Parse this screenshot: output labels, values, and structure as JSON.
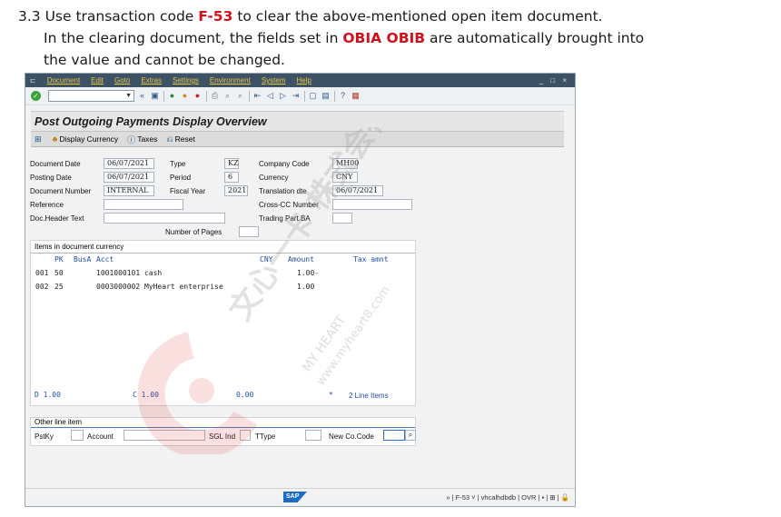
{
  "doc": {
    "line1_prefix": "3.3 Use transaction code ",
    "line1_code": "F-53",
    "line1_suffix": " to clear the above-mentioned open item document.",
    "line2_prefix": "In the clearing document, the fields set in ",
    "line2_fields": "OBIA OBIB",
    "line2_suffix": " are automatically brought into",
    "line3": "the value and cannot be changed."
  },
  "menu": [
    "Document",
    "Edit",
    "Goto",
    "Extras",
    "Settings",
    "Environment",
    "System",
    "Help"
  ],
  "window_controls": "_ □ ×",
  "title": "Post Outgoing Payments Display Overview",
  "app_toolbar": {
    "display_currency": "Display Currency",
    "taxes": "Taxes",
    "reset": "Reset"
  },
  "header": {
    "document_date_label": "Document Date",
    "document_date": "06/07/2021",
    "type_label": "Type",
    "type": "KZ",
    "company_code_label": "Company Code",
    "company_code": "MH00",
    "posting_date_label": "Posting Date",
    "posting_date": "06/07/2021",
    "period_label": "Period",
    "period": "6",
    "currency_label": "Currency",
    "currency": "CNY",
    "document_number_label": "Document Number",
    "document_number": "INTERNAL",
    "fiscal_year_label": "Fiscal Year",
    "fiscal_year": "2021",
    "translation_date_label": "Translation dte",
    "translation_date": "06/07/2021",
    "reference_label": "Reference",
    "reference": "",
    "cross_cc_label": "Cross-CC Number",
    "cross_cc": "",
    "doc_header_text_label": "Doc.Header Text",
    "doc_header_text": "",
    "trading_part_label": "Trading Part.BA",
    "trading_part": "",
    "number_of_pages_label": "Number of Pages",
    "number_of_pages": ""
  },
  "items": {
    "section_title": "Items in document currency",
    "col_pk": "PK",
    "col_busa": "BusA",
    "col_acct": "Acct",
    "col_currency": "CNY",
    "col_amount": "Amount",
    "col_tax": "Tax amnt",
    "rows": [
      {
        "no": "001",
        "pk": "50",
        "acct": "1001000101 cash",
        "amount": "1.00-"
      },
      {
        "no": "002",
        "pk": "25",
        "acct": "0003000002 MyHeart enterprise",
        "amount": "1.00"
      }
    ],
    "total_debit": "D 1.00",
    "total_credit": "C 1.00",
    "balance": "0.00",
    "star": "*",
    "item_count": "2 Line Items"
  },
  "other_line_item": {
    "title": "Other line item",
    "pstky_label": "PstKy",
    "account_label": "Account",
    "sgl_ind_label": "SGL Ind",
    "ttype_label": "TType",
    "new_cocode_label": "New Co.Code"
  },
  "status": {
    "sap_logo": "SAP",
    "right_text": "» | F-53 ˅ | vhcalhdbdb | OVR | ▪ | ⊞ | 🔓"
  },
  "watermark": {
    "chinese": "文心一卡 株式会社",
    "latin": "MY HEART",
    "url": "www.myheart8.com"
  },
  "colors": {
    "menu_bg": "#3e5266",
    "menu_fg": "#e8c840",
    "accent_red": "#d0101a",
    "watermark": "#e23a3a"
  }
}
